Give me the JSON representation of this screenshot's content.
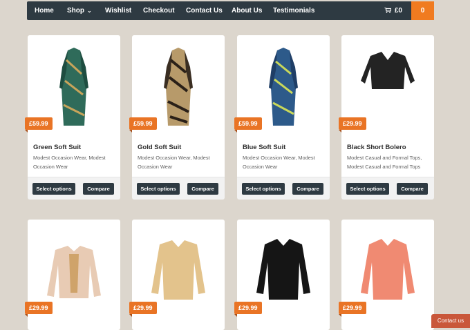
{
  "nav": {
    "items": [
      "Home",
      "Shop",
      "Wishlist",
      "Checkout",
      "Contact Us",
      "About Us",
      "Testimonials"
    ],
    "cart_total": "£0",
    "cart_count": "0"
  },
  "products": [
    {
      "name": "Green Soft Suit",
      "price": "£59.99",
      "categories": "Modest Occasion Wear, Modest Occasion Wear",
      "select_label": "Select options",
      "compare_label": "Compare",
      "color": "#2f6b5a"
    },
    {
      "name": "Gold Soft Suit",
      "price": "£59.99",
      "categories": "Modest Occasion Wear, Modest Occasion Wear",
      "select_label": "Select options",
      "compare_label": "Compare",
      "color": "#b79a6a"
    },
    {
      "name": "Blue Soft Suit",
      "price": "£59.99",
      "categories": "Modest Occasion Wear, Modest Occasion Wear",
      "select_label": "Select options",
      "compare_label": "Compare",
      "color": "#2d5a8a"
    },
    {
      "name": "Black Short Bolero",
      "price": "£29.99",
      "categories": "Modest Casual and Formal Tops, Modest Casual and Formal Tops",
      "select_label": "Select options",
      "compare_label": "Compare",
      "color": "#232323"
    },
    {
      "price": "£29.99",
      "color": "#e8cbb4"
    },
    {
      "price": "£29.99",
      "color": "#e3c38c"
    },
    {
      "price": "£29.99",
      "color": "#151515"
    },
    {
      "price": "£29.99",
      "color": "#f08a72"
    }
  ],
  "contact_tab": "Contact us"
}
